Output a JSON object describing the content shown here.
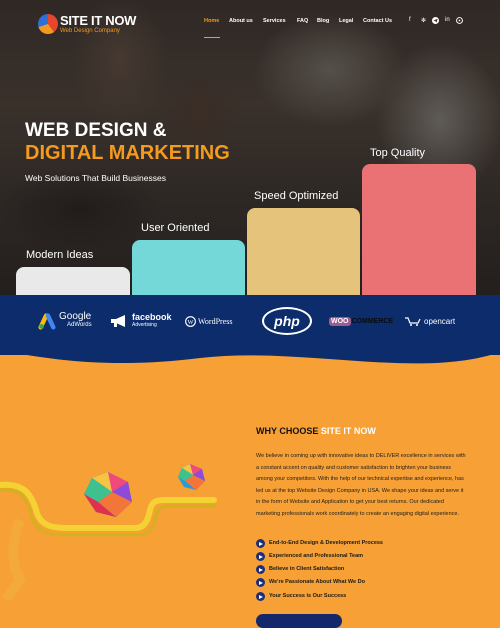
{
  "header": {
    "logo": {
      "title": "SITE IT NOW",
      "subtitle": "Web Design Company"
    },
    "nav": [
      "Home",
      "About us",
      "Services",
      "FAQ",
      "Blog",
      "Legal",
      "Contact Us"
    ],
    "active_nav": "Home",
    "social_icons": [
      "facebook-icon",
      "yelp-icon",
      "telegram-icon",
      "linkedin-icon",
      "pinterest-icon"
    ]
  },
  "hero": {
    "title_line1": "WEB DESIGN &",
    "title_line2": "DIGITAL MARKETING",
    "tagline": "Web Solutions That Build Businesses",
    "bars": [
      {
        "label": "Modern Ideas",
        "color": "#e9e9ea"
      },
      {
        "label": "User Oriented",
        "color": "#74d8d9"
      },
      {
        "label": "Speed Optimized",
        "color": "#e6c37a"
      },
      {
        "label": "Top Quality",
        "color": "#ea7274"
      }
    ]
  },
  "partners": {
    "google": {
      "name": "Google",
      "sub": "AdWords"
    },
    "facebook": {
      "name": "facebook",
      "sub": "Advertising"
    },
    "wordpress": "WordPress",
    "php": "php",
    "woocommerce": {
      "woo": "WOO",
      "commerce": "COMMERCE"
    },
    "opencart": "opencart"
  },
  "why": {
    "title_prefix": "WHY CHOOSE",
    "title_highlight": "SITE IT NOW",
    "paragraph": "We believe in coming up with innovative ideas to DELIVER excellence in services with a constant accent on quality and customer satisfaction to brighten your business among your competitors. With the help of our technical expertise and experience, has led us at the top Website Design Company in USA. We shape your ideas and serve it in the form of Website and Application to get your best returns. Our dedicated marketing professionals work coordinately to create an engaging digital experience.",
    "features": [
      "End-to-End Design & Development Process",
      "Experienced and Professional Team",
      "Believe in Client Satisfaction",
      "We're Passionate About What We Do",
      "Your Success is Our Success"
    ]
  },
  "colors": {
    "accent": "#f39a1f",
    "navy": "#0c2c6b",
    "orange_bg": "#f6a035"
  }
}
